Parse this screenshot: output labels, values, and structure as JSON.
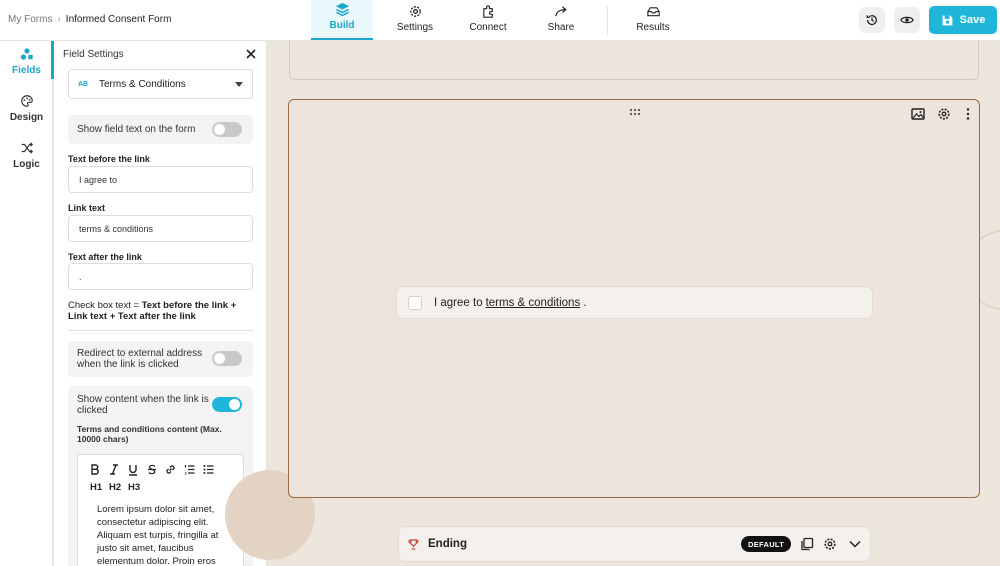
{
  "breadcrumb": {
    "root": "My Forms",
    "separator": "›",
    "current": "Informed Consent Form"
  },
  "nav": {
    "build": "Build",
    "settings": "Settings",
    "connect": "Connect",
    "share": "Share",
    "results": "Results"
  },
  "toolbar": {
    "save_label": "Save"
  },
  "rail": {
    "fields": "Fields",
    "design": "Design",
    "logic": "Logic"
  },
  "panel": {
    "title": "Field Settings",
    "field_type": "Terms & Conditions",
    "field_type_icon_text": "AB",
    "show_field_text_label": "Show field text on the form",
    "text_before_label": "Text before the link",
    "text_before_value": "I agree to",
    "link_text_label": "Link text",
    "link_text_value": "terms & conditions",
    "text_after_label": "Text after the link",
    "text_after_value": ".",
    "note_prefix": "Check box text = ",
    "note_formula": "Text before the link + Link text + Text after the link",
    "redirect_label": "Redirect to external address when the link is clicked",
    "show_content_label": "Show content when the link is clicked",
    "content_label": "Terms and conditions content (Max. 10000 chars)",
    "editor_h1": "H1",
    "editor_h2": "H2",
    "editor_h3": "H3",
    "editor_text": "Lorem ipsum dolor sit amet, consectetur adipiscing elit. Aliquam est turpis, fringilla at justo sit amet, faucibus elementum dolor. Proin eros"
  },
  "canvas": {
    "check_before": "I agree to",
    "check_link": "terms & conditions",
    "check_after": ".",
    "ending_label": "Ending",
    "ending_badge": "DEFAULT"
  },
  "colors": {
    "accent": "#20b6d9",
    "card_border": "#9a6a43",
    "canvas_bg": "#ede6dd"
  }
}
